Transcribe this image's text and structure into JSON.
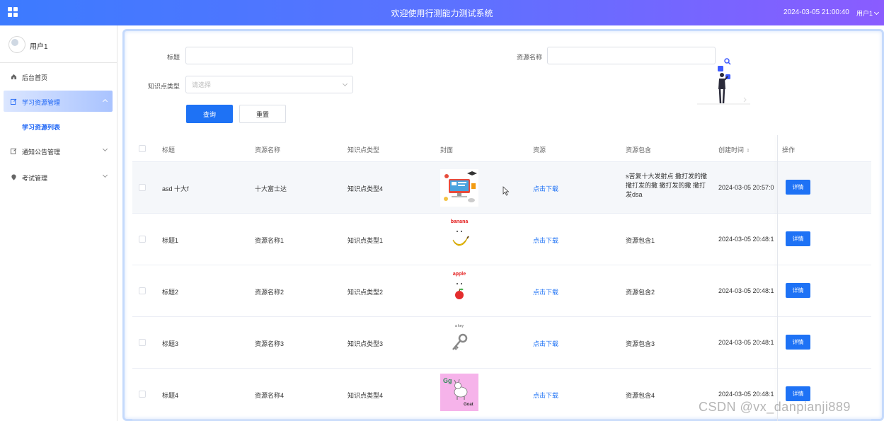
{
  "header": {
    "title": "欢迎使用行测能力测试系统",
    "datetime": "2024-03-05 21:00:40",
    "user": "用户1",
    "icon": "grid-icon"
  },
  "sidebar": {
    "user_name": "用户1",
    "items": [
      {
        "label": "后台首页",
        "icon": "home-icon"
      },
      {
        "label": "学习资源管理",
        "icon": "edit-icon",
        "active": true
      },
      {
        "label": "通知公告管理",
        "icon": "edit-icon"
      },
      {
        "label": "考试管理",
        "icon": "location-icon"
      }
    ],
    "submenu": {
      "label": "学习资源列表"
    }
  },
  "search": {
    "title_label": "标题",
    "title_value": "",
    "name_label": "资源名称",
    "name_value": "",
    "type_label": "知识点类型",
    "type_placeholder": "请选择",
    "query_button": "查询",
    "reset_button": "重置"
  },
  "table": {
    "columns": [
      "标题",
      "资源名称",
      "知识点类型",
      "封面",
      "资源",
      "资源包含",
      "创建时间",
      "操作"
    ],
    "sort_icon": "⇕",
    "rows": [
      {
        "title": "asd 十大f",
        "name": "十大富士达",
        "type": "知识点类型4",
        "cover": "computer-classroom-image",
        "resource": "点击下载",
        "contains": "s苦复十大发射点 撒打发的撒 撒打发的撒 撒打发的撒 撒打发dsa",
        "time": "2024-03-05 20:57:0",
        "action": "详情"
      },
      {
        "title": "标题1",
        "name": "资源名称1",
        "type": "知识点类型1",
        "cover": "banana-image",
        "resource": "点击下载",
        "contains": "资源包含1",
        "time": "2024-03-05 20:48:1",
        "action": "详情"
      },
      {
        "title": "标题2",
        "name": "资源名称2",
        "type": "知识点类型2",
        "cover": "apple-image",
        "resource": "点击下载",
        "contains": "资源包含2",
        "time": "2024-03-05 20:48:1",
        "action": "详情"
      },
      {
        "title": "标题3",
        "name": "资源名称3",
        "type": "知识点类型3",
        "cover": "key-image",
        "resource": "点击下载",
        "contains": "资源包含3",
        "time": "2024-03-05 20:48:1",
        "action": "详情"
      },
      {
        "title": "标题4",
        "name": "资源名称4",
        "type": "知识点类型4",
        "cover": "goat-image",
        "resource": "点击下载",
        "contains": "资源包含4",
        "time": "2024-03-05 20:48:1",
        "action": "详情"
      }
    ]
  },
  "covers": {
    "banana_word": "banana",
    "apple_word": "apple",
    "key_word": "a key",
    "goat_letters": "Gg",
    "goat_word": "Goat"
  },
  "watermark": "CSDN @vx_danpianji889",
  "colors": {
    "primary": "#1e72f5",
    "header_start": "#3c7bff",
    "header_end": "#8a5cff"
  }
}
